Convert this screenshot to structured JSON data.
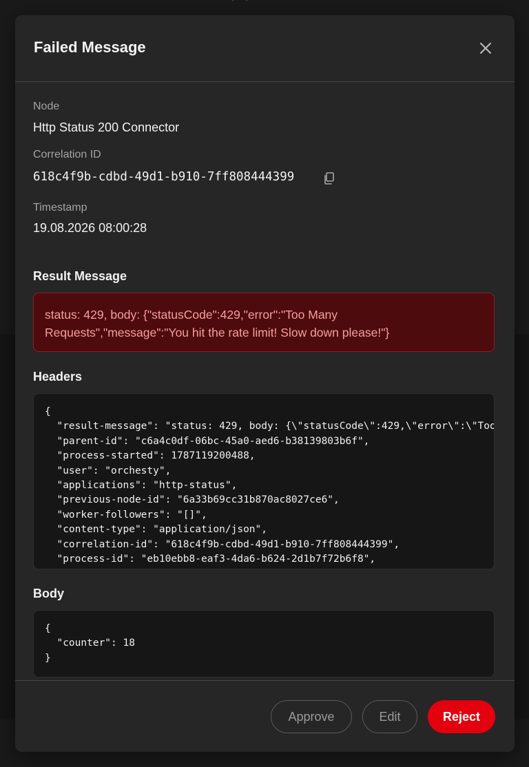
{
  "modal": {
    "title": "Failed Message",
    "close_icon": "close-icon"
  },
  "fields": {
    "node_label": "Node",
    "node_value": "Http Status 200 Connector",
    "correlation_label": "Correlation ID",
    "correlation_value": "618c4f9b-cdbd-49d1-b910-7ff808444399",
    "copy_icon": "copy-icon",
    "timestamp_label": "Timestamp",
    "timestamp_value": "19.08.2026 08:00:28"
  },
  "result": {
    "title": "Result Message",
    "message": "status: 429, body: {\"statusCode\":429,\"error\":\"Too Many Requests\",\"message\":\"You hit the rate limit! Slow down please!\"}"
  },
  "headers": {
    "title": "Headers",
    "content": "{\n  \"result-message\": \"status: 429, body: {\\\"statusCode\\\":429,\\\"error\\\":\\\"Too Many Requests\\\",\\\"message\\\":\\\"You hit the rate limit! Slow down please!\\\"}\",\n  \"parent-id\": \"c6a4c0df-06bc-45a0-aed6-b38139803b6f\",\n  \"process-started\": 1787119200488,\n  \"user\": \"orchesty\",\n  \"applications\": \"http-status\",\n  \"previous-node-id\": \"6a33b69cc31b870ac8027ce6\",\n  \"worker-followers\": \"[]\",\n  \"content-type\": \"application/json\",\n  \"correlation-id\": \"618c4f9b-cdbd-49d1-b910-7ff808444399\",\n  \"process-id\": \"eb10ebb8-eaf3-4da6-b624-2d1b7f72b6f8\","
  },
  "body": {
    "title": "Body",
    "content": "{\n  \"counter\": 18\n}"
  },
  "footer": {
    "approve_label": "Approve",
    "edit_label": "Edit",
    "reject_label": "Reject"
  },
  "colors": {
    "reject": "#e3000f",
    "error_bg": "#4d0b0d",
    "error_text": "#f59ea0"
  }
}
